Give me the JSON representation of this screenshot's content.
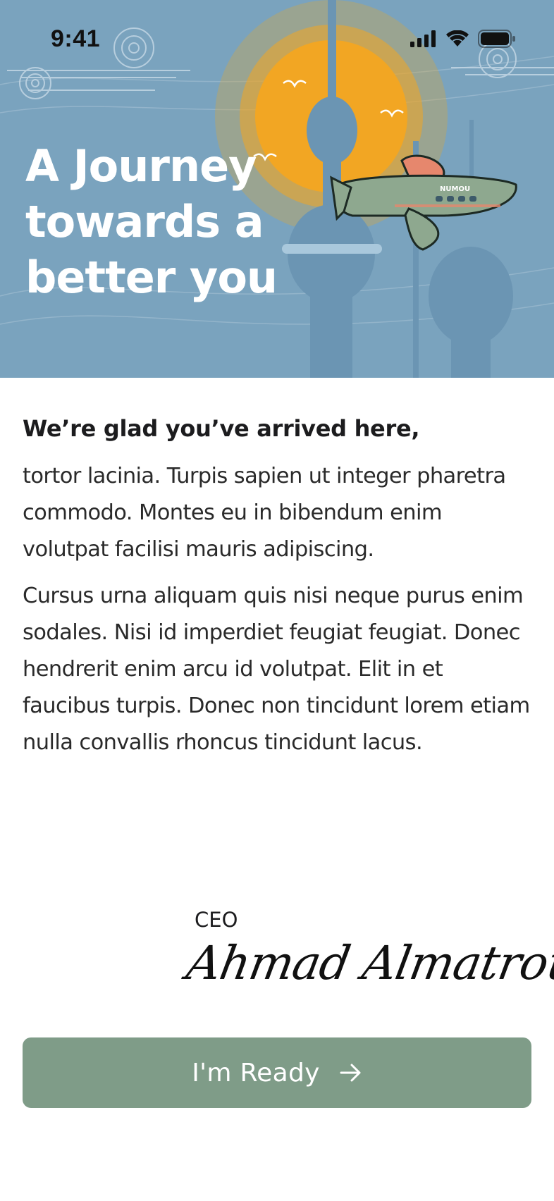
{
  "status_bar": {
    "time": "9:41"
  },
  "hero": {
    "title_lines": [
      "A Journey",
      "towards a",
      "better you"
    ],
    "plane_label": "NUMOU"
  },
  "welcome": {
    "greeting": "We’re glad you’ve arrived here,",
    "paragraphs": [
      "tortor lacinia. Turpis sapien ut integer pharetra commodo. Montes eu in bibendum enim volutpat facilisi mauris adipiscing.",
      "Cursus urna aliquam quis nisi neque purus enim sodales. Nisi id imperdiet feugiat feugiat. Donec hendrerit enim arcu id volutpat. Elit in et faucibus turpis. Donec non tincidunt lorem etiam nulla convallis rhoncus tincidunt lacus."
    ]
  },
  "signature": {
    "role": "CEO",
    "name": "Ahmad Almatrouk"
  },
  "cta": {
    "label": "I'm Ready",
    "icon": "arrow-right-icon"
  },
  "colors": {
    "hero_bg": "#7aa3be",
    "sun": "#f2a623",
    "tower": "#6b95b3",
    "button": "#7f9c88"
  }
}
